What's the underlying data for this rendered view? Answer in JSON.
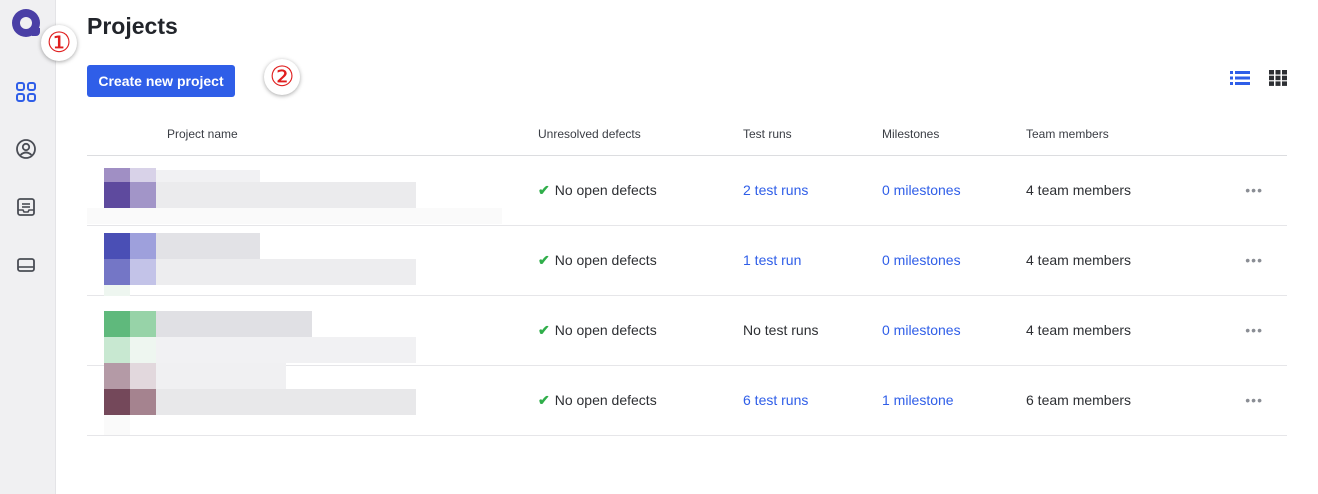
{
  "app": {
    "page_title": "Projects",
    "create_button_label": "Create new project"
  },
  "annotations": {
    "badge_1": "①",
    "badge_2": "②"
  },
  "sidebar": {
    "items": [
      {
        "name": "projects",
        "icon": "grid-icon"
      },
      {
        "name": "profile",
        "icon": "user-circle-icon"
      },
      {
        "name": "inbox",
        "icon": "inbox-icon"
      },
      {
        "name": "devices",
        "icon": "device-icon"
      }
    ],
    "accent": "#2f5ee8"
  },
  "table": {
    "headers": [
      "Project name",
      "Unresolved defects",
      "Test runs",
      "Milestones",
      "Team members"
    ],
    "rows": [
      {
        "defects": "No open defects",
        "test_runs": "2 test runs",
        "test_runs_link": true,
        "milestones": "0 milestones",
        "team": "4 team members"
      },
      {
        "defects": "No open defects",
        "test_runs": "1 test run",
        "test_runs_link": true,
        "milestones": "0 milestones",
        "team": "4 team members"
      },
      {
        "defects": "No open defects",
        "test_runs": "No test runs",
        "test_runs_link": false,
        "milestones": "0 milestones",
        "team": "4 team members"
      },
      {
        "defects": "No open defects",
        "test_runs": "6 test runs",
        "test_runs_link": true,
        "milestones": "1 milestone",
        "team": "6 team members"
      }
    ],
    "more_label": "•••"
  },
  "colors": {
    "primary": "#2f5ee8",
    "success": "#2fae4a",
    "row_avatar_1": "#5e4a9e",
    "row_avatar_2": "#4a4fb5",
    "row_avatar_3": "#5fb97c",
    "row_avatar_4": "#74485a"
  }
}
